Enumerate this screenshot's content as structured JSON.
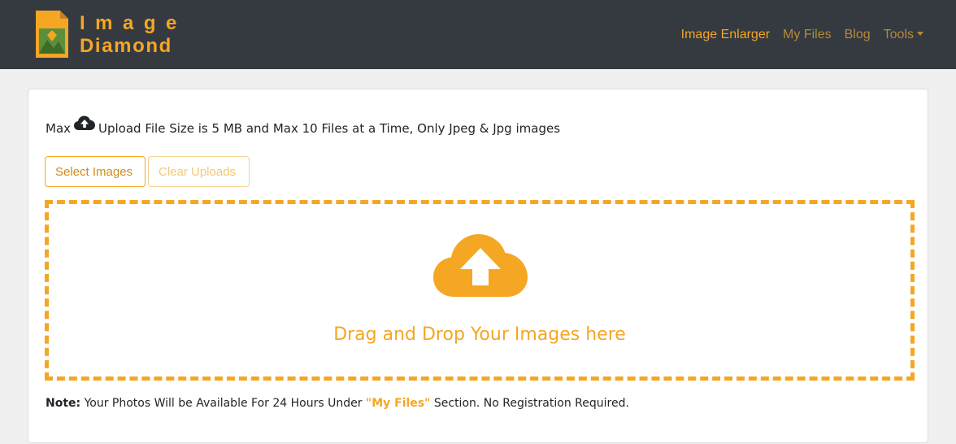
{
  "brand": {
    "line1": "Image",
    "line2": "Diamond",
    "color": "#f5a623",
    "icon": "image-diamond-logo-icon"
  },
  "nav": {
    "items": [
      {
        "label": "Image Enlarger",
        "active": true
      },
      {
        "label": "My Files",
        "active": false
      },
      {
        "label": "Blog",
        "active": false
      },
      {
        "label": "Tools",
        "active": false,
        "dropdown": true
      }
    ]
  },
  "upload": {
    "info_prefix": "Max",
    "info_suffix": "Upload File Size is 5 MB and Max 10 Files at a Time, Only Jpeg & Jpg images",
    "info_icon": "cloud-upload-icon",
    "select_label": "Select Images",
    "clear_label": "Clear Uploads",
    "drop_text": "Drag and Drop Your Images here",
    "drop_icon": "cloud-upload-icon"
  },
  "note": {
    "label": "Note:",
    "text_before": " Your Photos Will be Available For 24 Hours Under ",
    "link": "\"My Files\"",
    "text_after": " Section. No Registration Required."
  },
  "colors": {
    "navbar": "#343a40",
    "accent": "#f5a623",
    "page_bg": "#f0f0f0"
  }
}
